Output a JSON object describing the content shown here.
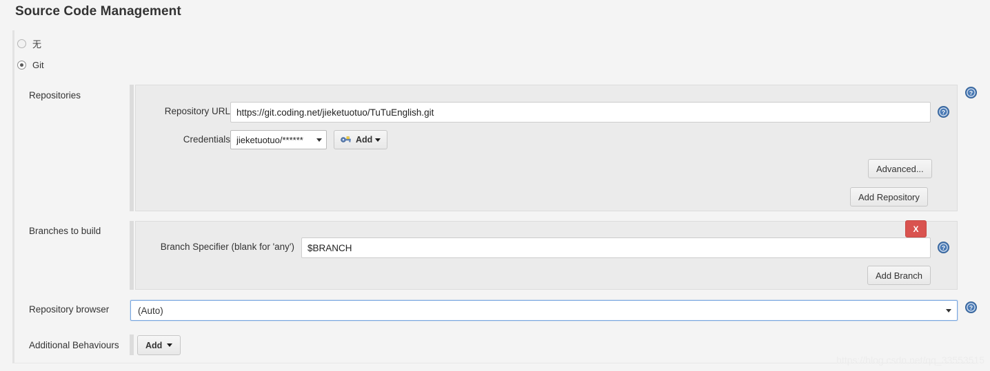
{
  "page": {
    "title": "Source Code Management"
  },
  "scm_options": [
    {
      "label": "无",
      "selected": false,
      "name": "none"
    },
    {
      "label": "Git",
      "selected": true,
      "name": "git"
    }
  ],
  "sections": {
    "repositories": {
      "label": "Repositories",
      "fields": {
        "repository_url": {
          "label": "Repository URL",
          "value": "https://git.coding.net/jieketuotuo/TuTuEnglish.git"
        },
        "credentials": {
          "label": "Credentials",
          "value": "jieketuotuo/******",
          "add_button": "Add"
        }
      },
      "buttons": {
        "advanced": "Advanced...",
        "add_repository": "Add Repository"
      }
    },
    "branches": {
      "label": "Branches to build",
      "fields": {
        "branch_specifier": {
          "label": "Branch Specifier (blank for 'any')",
          "value": "$BRANCH"
        }
      },
      "buttons": {
        "delete": "X",
        "add_branch": "Add Branch"
      }
    },
    "repository_browser": {
      "label": "Repository browser",
      "value": "(Auto)"
    },
    "additional_behaviours": {
      "label": "Additional Behaviours",
      "add_button": "Add"
    }
  },
  "icons": {
    "help": "help-icon",
    "key": "key-icon",
    "caret_down": "chevron-down-icon"
  },
  "watermark": "https://blog.csdn.net/qq_33553515",
  "colors": {
    "page_bg": "#f4f4f4",
    "panel_bg": "#ebebeb",
    "panel_border": "#dcdcdc",
    "delete_red": "#d9534f",
    "focus_blue": "#7aa7e0",
    "help_blue": "#3b6ea5"
  }
}
